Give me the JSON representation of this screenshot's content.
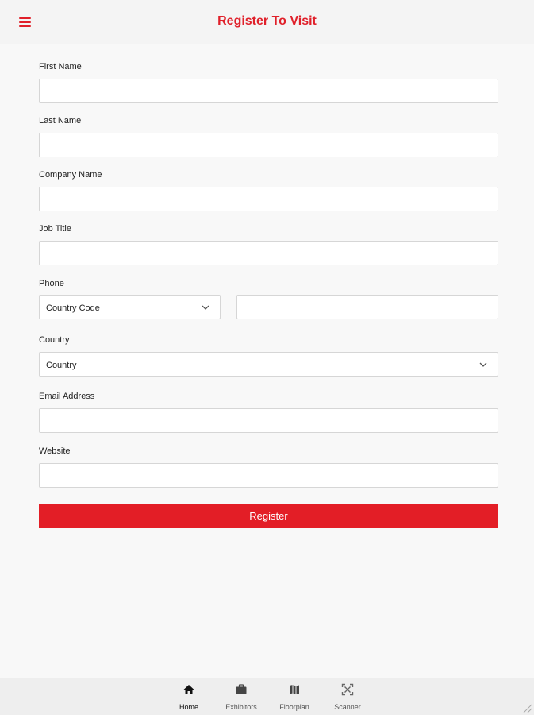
{
  "header": {
    "title": "Register To Visit",
    "menu_icon": "hamburger-menu-icon",
    "accent_color": "#e0202a"
  },
  "form": {
    "first_name": {
      "label": "First Name",
      "value": "",
      "placeholder": ""
    },
    "last_name": {
      "label": "Last Name",
      "value": "",
      "placeholder": ""
    },
    "company_name": {
      "label": "Company Name",
      "value": "",
      "placeholder": ""
    },
    "job_title": {
      "label": "Job Title",
      "value": "",
      "placeholder": ""
    },
    "phone": {
      "label": "Phone",
      "country_code_selected": "Country Code",
      "number_value": ""
    },
    "country": {
      "label": "Country",
      "selected": "Country"
    },
    "email": {
      "label": "Email Address",
      "value": "",
      "placeholder": ""
    },
    "website": {
      "label": "Website",
      "value": "",
      "placeholder": ""
    },
    "submit_label": "Register",
    "submit_color": "#e31e26"
  },
  "tabbar": {
    "items": [
      {
        "label": "Home",
        "icon": "home-icon",
        "active": true
      },
      {
        "label": "Exhibitors",
        "icon": "briefcase-icon",
        "active": false
      },
      {
        "label": "Floorplan",
        "icon": "map-icon",
        "active": false
      },
      {
        "label": "Scanner",
        "icon": "qr-scanner-icon",
        "active": false
      }
    ]
  }
}
